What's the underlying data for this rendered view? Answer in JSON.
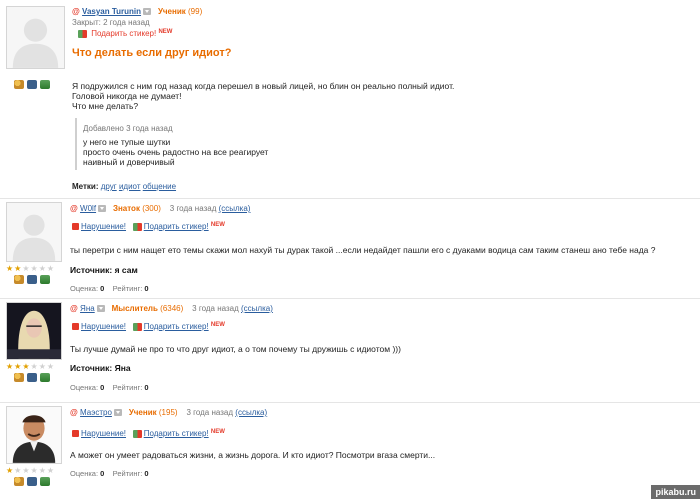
{
  "question": {
    "author": "Vasyan Turunin",
    "rank": "Ученик",
    "rank_points": "(99)",
    "closed": "Закрыт: 2 года назад",
    "sticker": "Подарить стикер!",
    "new_badge": "NEW",
    "title": "Что делать если друг идиот?",
    "body": [
      "Я подружился с ним год назад когда перешел в новый лицей, но блин он реально полный идиот.",
      "Головой никогда не думает!",
      "Что мне делать?"
    ],
    "addendum_time": "Добавлено 3 года назад",
    "addendum": [
      "у него не тупые шутки",
      "просто очень очень радостно на все реагирует",
      "наивный и доверчивый"
    ],
    "tags_label": "Метки:",
    "tags": [
      "друг",
      "идиот",
      "общение"
    ]
  },
  "answers": [
    {
      "author": "W0lf",
      "rank": "Знаток",
      "rank_points": "(300)",
      "time": "3 года назад",
      "link": "(ссылка)",
      "violation": "Нарушение!",
      "sticker": "Подарить стикер!",
      "new_badge": "NEW",
      "text": "ты перетри с ним нащет ето темы скажи мол нахуй ты дурак такой ...если недайдет пашли его с дуаками водица сам таким станеш ано тебе нада ?",
      "source": "Источник: я сам",
      "rating_label": "Оценка:",
      "rating_value": "0",
      "score_label": "Рейтинг:",
      "score_value": "0",
      "stars": 2
    },
    {
      "author": "Яна",
      "rank": "Мыслитель",
      "rank_points": "(6346)",
      "time": "3 года назад",
      "link": "(ссылка)",
      "violation": "Нарушение!",
      "sticker": "Подарить стикер!",
      "new_badge": "NEW",
      "text": "Ты лучше думай не про то что друг идиот, а о том почему ты дружишь с идиотом )))",
      "source": "Источник: Яна",
      "rating_label": "Оценка:",
      "rating_value": "0",
      "score_label": "Рейтинг:",
      "score_value": "0",
      "stars": 3
    },
    {
      "author": "Маэстро",
      "rank": "Ученик",
      "rank_points": "(195)",
      "time": "3 года назад",
      "link": "(ссылка)",
      "violation": "Нарушение!",
      "sticker": "Подарить стикер!",
      "new_badge": "NEW",
      "text": "А может он умеет радоваться жизни, а жизнь дорога. И кто идиот? Посмотри вгаза смерти...",
      "rating_label": "Оценка:",
      "rating_value": "0",
      "score_label": "Рейтинг:",
      "score_value": "0",
      "stars": 1
    }
  ],
  "watermark": "pikabu.ru",
  "colors": {
    "accent": "#e86c00",
    "link": "#2a5d9e",
    "alert": "#e43a2a"
  }
}
